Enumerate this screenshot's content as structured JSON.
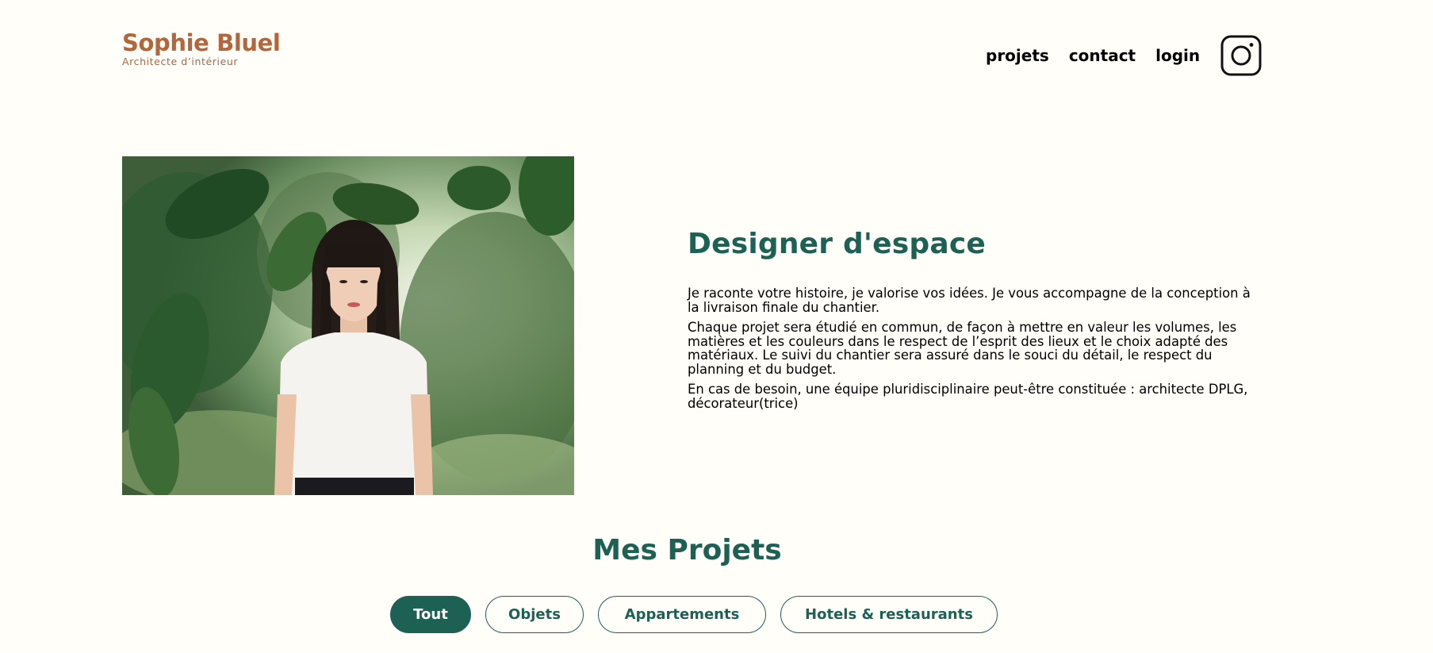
{
  "brand": {
    "name": "Sophie Bluel",
    "tagline": "Architecte d’intérieur",
    "color": "#B1663C"
  },
  "nav": {
    "projets": "projets",
    "contact": "contact",
    "login": "login",
    "social_icon": "instagram-icon"
  },
  "intro": {
    "image_subject": "portrait photo of a woman in a white top among green foliage",
    "title": "Designer d'espace",
    "paragraphs": [
      "Je raconte votre histoire, je valorise vos idées. Je vous accompagne de la conception à la livraison finale du chantier.",
      "Chaque projet sera étudié en commun, de façon à mettre en valeur les volumes, les matières et les couleurs dans le respect de l’esprit des lieux et le choix adapté des matériaux. Le suivi du chantier sera assuré dans le souci du détail, le respect du planning et du budget.",
      "En cas de besoin, une équipe pluridisciplinaire peut-être constituée : architecte DPLG, décorateur(trice)"
    ]
  },
  "projects": {
    "title": "Mes Projets",
    "filters": [
      {
        "label": "Tout",
        "active": true
      },
      {
        "label": "Objets",
        "active": false
      },
      {
        "label": "Appartements",
        "active": false
      },
      {
        "label": "Hotels & restaurants",
        "active": false
      }
    ]
  },
  "colors": {
    "background": "#FFFEF8",
    "accent": "#1D6154"
  }
}
